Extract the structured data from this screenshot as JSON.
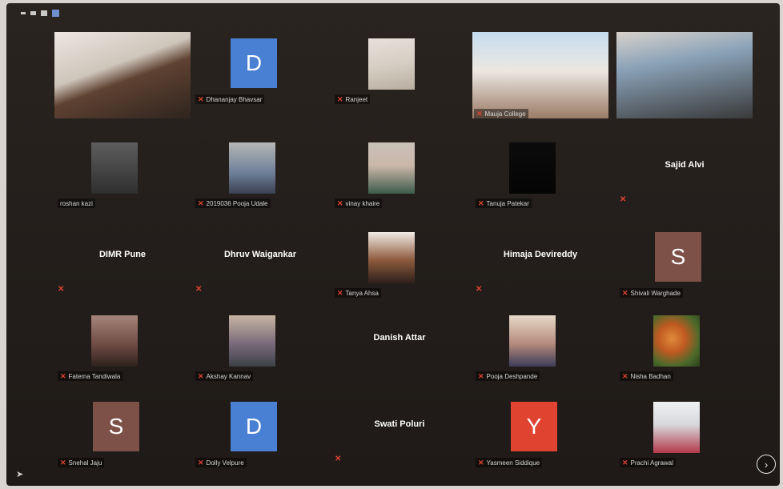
{
  "toolbar": {
    "view_icons": [
      "minimize-icon",
      "restore-icon",
      "list-view-icon",
      "gallery-view-icon"
    ]
  },
  "participants": [
    {
      "row": 0,
      "col": 0,
      "display": "video",
      "label": "",
      "muted": false,
      "video": "vid-a"
    },
    {
      "row": 0,
      "col": 1,
      "display": "avatar",
      "initial": "D",
      "avatar_color": "#4a80d3",
      "label": "Dhananjay Bhavsar",
      "muted": true
    },
    {
      "row": 0,
      "col": 2,
      "display": "video",
      "label": "Ranjeet",
      "muted": true,
      "video": "vid-b"
    },
    {
      "row": 0,
      "col": 3,
      "display": "video",
      "label": "Mauja College",
      "muted": true,
      "video": "vid-d"
    },
    {
      "row": 0,
      "col": 4,
      "display": "video",
      "label": "",
      "muted": false,
      "video": "vid-c"
    },
    {
      "row": 1,
      "col": 0,
      "display": "video",
      "label": "roshan kazi",
      "muted": false,
      "video": "vid-e"
    },
    {
      "row": 1,
      "col": 1,
      "display": "video",
      "label": "2019036 Pooja Udale",
      "muted": true,
      "video": "vid-f"
    },
    {
      "row": 1,
      "col": 2,
      "display": "video",
      "label": "vinay khaire",
      "muted": true,
      "video": "vid-g"
    },
    {
      "row": 1,
      "col": 3,
      "display": "video",
      "label": "Tanuja Patekar",
      "muted": true,
      "video": "vid-h"
    },
    {
      "row": 1,
      "col": 4,
      "display": "name",
      "name": "Sajid Alvi",
      "label": "",
      "muted": true
    },
    {
      "row": 2,
      "col": 0,
      "display": "name",
      "name": "DIMR Pune",
      "label": "",
      "muted": true
    },
    {
      "row": 2,
      "col": 1,
      "display": "name",
      "name": "Dhruv Waigankar",
      "label": "",
      "muted": true
    },
    {
      "row": 2,
      "col": 2,
      "display": "video",
      "label": "Tanya Ahsa",
      "muted": true,
      "video": "vid-i"
    },
    {
      "row": 2,
      "col": 3,
      "display": "name",
      "name": "Himaja Devireddy",
      "label": "",
      "muted": true
    },
    {
      "row": 2,
      "col": 4,
      "display": "avatar",
      "initial": "S",
      "avatar_color": "#7d5048",
      "label": "Shivali Warghade",
      "muted": true
    },
    {
      "row": 3,
      "col": 0,
      "display": "video",
      "label": "Fatema Tandiwala",
      "muted": true,
      "video": "vid-j"
    },
    {
      "row": 3,
      "col": 1,
      "display": "video",
      "label": "Akshay Kannav",
      "muted": true,
      "video": "vid-k"
    },
    {
      "row": 3,
      "col": 2,
      "display": "name",
      "name": "Danish Attar",
      "label": "",
      "muted": false
    },
    {
      "row": 3,
      "col": 3,
      "display": "video",
      "label": "Pooja Deshpande",
      "muted": true,
      "video": "vid-l"
    },
    {
      "row": 3,
      "col": 4,
      "display": "video",
      "label": "Nisha Badhan",
      "muted": true,
      "video": "vid-m"
    },
    {
      "row": 4,
      "col": 0,
      "display": "avatar",
      "initial": "S",
      "avatar_color": "#7d5048",
      "label": "Snehal Jaju",
      "muted": true
    },
    {
      "row": 4,
      "col": 1,
      "display": "avatar",
      "initial": "D",
      "avatar_color": "#4a80d3",
      "label": "Dolly Velpure",
      "muted": true
    },
    {
      "row": 4,
      "col": 2,
      "display": "name",
      "name": "Swati Poluri",
      "label": "",
      "muted": true
    },
    {
      "row": 4,
      "col": 3,
      "display": "avatar",
      "initial": "Y",
      "avatar_color": "#e0432f",
      "label": "Yasmeen Siddique",
      "muted": true
    },
    {
      "row": 4,
      "col": 4,
      "display": "video",
      "label": "Prachi Agrawal",
      "muted": true,
      "video": "vid-n"
    }
  ],
  "next_page_icon": "chevron-right-icon",
  "corner_icon": "pointer-icon"
}
